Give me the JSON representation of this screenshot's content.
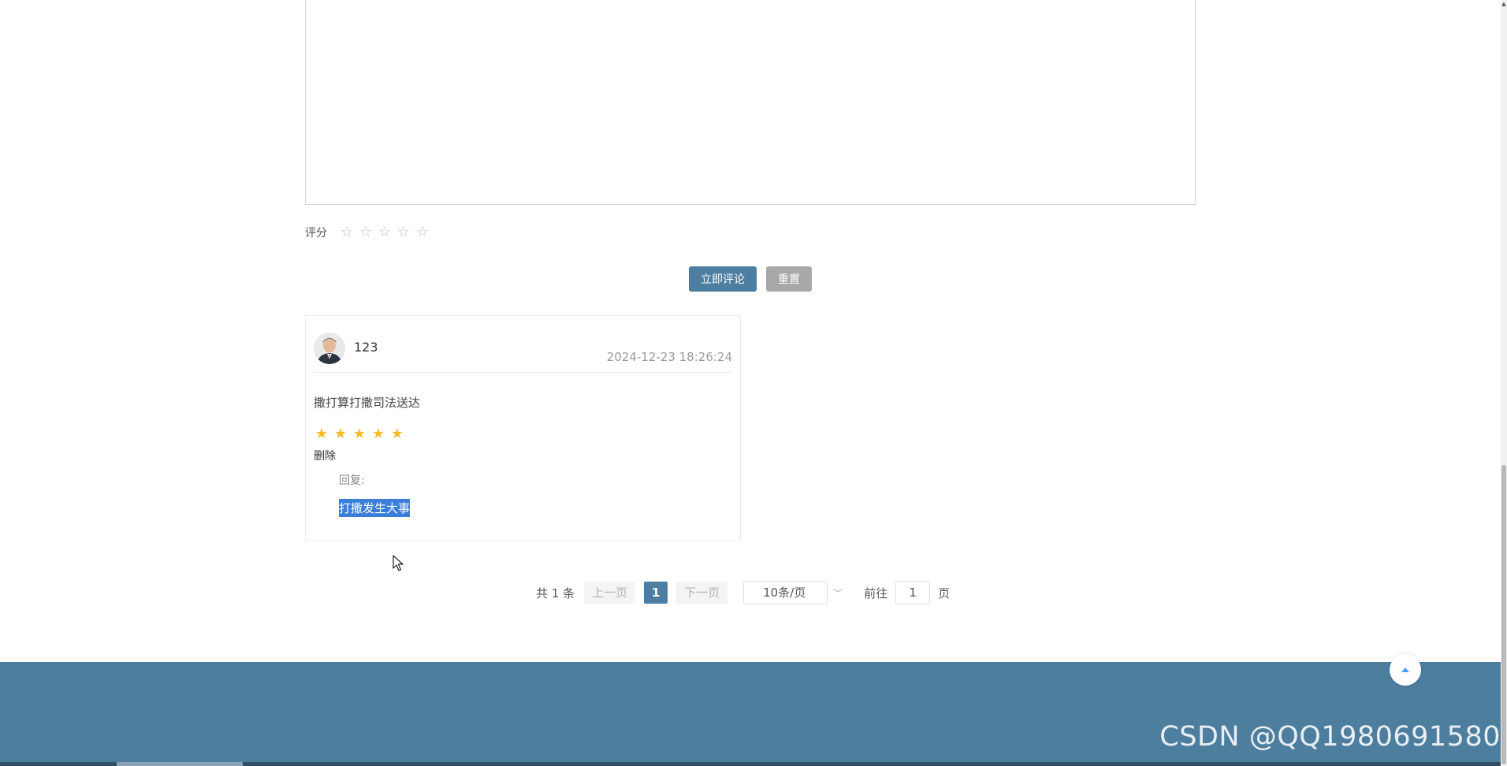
{
  "comment_form": {
    "textarea_value": "",
    "rating_label": "评分",
    "rating_value": 0,
    "rating_max": 5,
    "submit_label": "立即评论",
    "reset_label": "重置"
  },
  "comments": [
    {
      "username": "123",
      "time": "2024-12-23 18:26:24",
      "content": "撒打算打撒司法送达",
      "rating": 5,
      "delete_label": "删除",
      "reply_label": "回复:",
      "reply_content": "打撒发生大事"
    }
  ],
  "pagination": {
    "total_text": "共 1 条",
    "prev_label": "上一页",
    "current_page": "1",
    "next_label": "下一页",
    "page_size": "10条/页",
    "goto_label": "前往",
    "goto_value": "1",
    "page_unit": "页"
  },
  "footer": {
    "watermark": "CSDN @QQ1980691580"
  },
  "colors": {
    "primary": "#4d7da0",
    "footer": "#4d7e9e",
    "star": "#f7ba2a",
    "selection": "#3a7ed8"
  },
  "icons": {
    "star_empty": "star-outline-icon",
    "star_full": "star-filled-icon",
    "back_to_top": "caret-up-icon",
    "select_arrow": "chevron-down-icon",
    "cursor": "mouse-pointer-icon"
  }
}
